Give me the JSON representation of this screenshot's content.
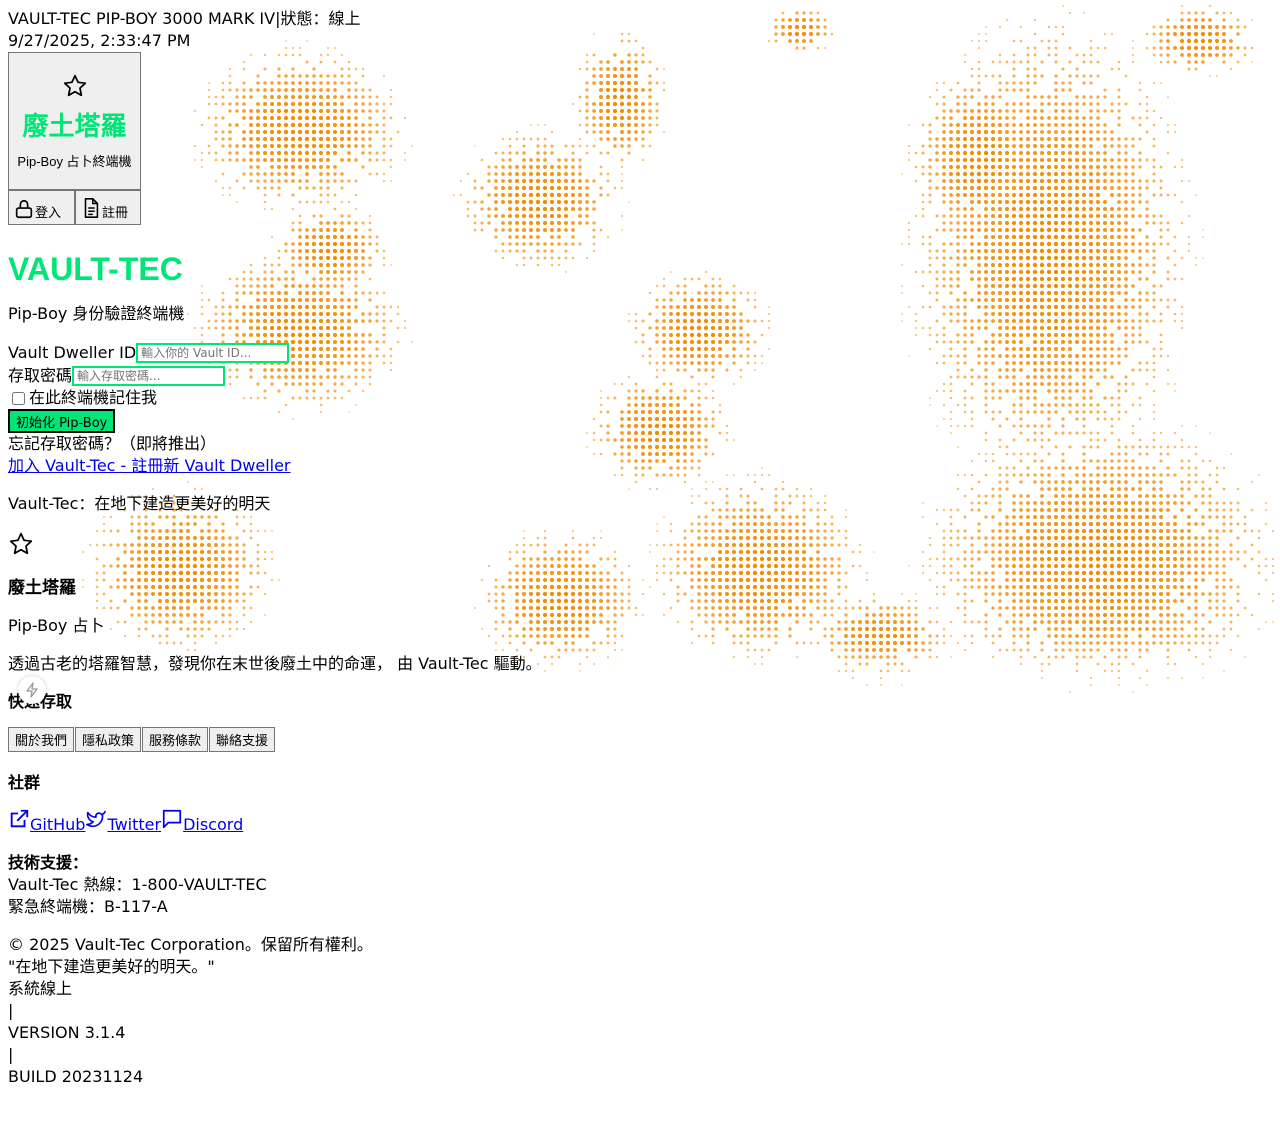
{
  "header": {
    "system_line": "VAULT-TEC PIP-BOY 3000 MARK IV",
    "separator": "|",
    "status": "狀態：線上",
    "datetime": "9/27/2025, 2:33:47 PM"
  },
  "logo": {
    "icon": "star-icon",
    "title": "廢土塔羅",
    "subtitle": "Pip-Boy 占卜終端機"
  },
  "auth_nav": {
    "login_label": "登入",
    "login_icon": "lock-icon",
    "register_label": "註冊",
    "register_icon": "document-icon"
  },
  "login": {
    "brand": "VAULT-TEC",
    "subtitle": "Pip-Boy 身份驗證終端機",
    "id_label": "Vault Dweller ID",
    "id_placeholder": "輸入你的 Vault ID...",
    "password_label": "存取密碼",
    "password_placeholder": "輸入存取密碼...",
    "remember_label": "在此終端機記住我",
    "submit_label": "初始化 Pip-Boy",
    "forgot_text": "忘記存取密碼？（即將推出）",
    "register_link": "加入 Vault-Tec - 註冊新 Vault Dweller",
    "slogan": "Vault-Tec：在地下建造更美好的明天"
  },
  "footer": {
    "icon": "star-icon",
    "title": "廢土塔羅",
    "subtitle": "Pip-Boy 占卜",
    "description": "透過古老的塔羅智慧，發現你在末世後廢土中的命運， 由 Vault-Tec 驅動。",
    "quick_access_title": "快速存取",
    "quick_links": [
      "關於我們",
      "隱私政策",
      "服務條款",
      "聯絡支援"
    ],
    "social_title": "社群",
    "social_links": [
      {
        "label": "GitHub",
        "icon": "external-link-icon"
      },
      {
        "label": "Twitter",
        "icon": "twitter-bird-icon"
      },
      {
        "label": "Discord",
        "icon": "chat-bubble-icon"
      }
    ],
    "support_title": "技術支援：",
    "hotline": "Vault-Tec 熱線：1-800-VAULT-TEC",
    "emergency": "緊急終端機：B-117-A",
    "copyright": "© 2025 Vault-Tec Corporation。保留所有權利。",
    "quote": "\"在地下建造更美好的明天。\"",
    "system_status": "系統線上",
    "sep": "|",
    "version": "VERSION 3.1.4",
    "build": "BUILD 20231124"
  },
  "colors": {
    "accent": "#00e676",
    "background_dots": "#f28c00",
    "link": "#0000ee"
  },
  "floating_button_icon": "lightning-icon"
}
